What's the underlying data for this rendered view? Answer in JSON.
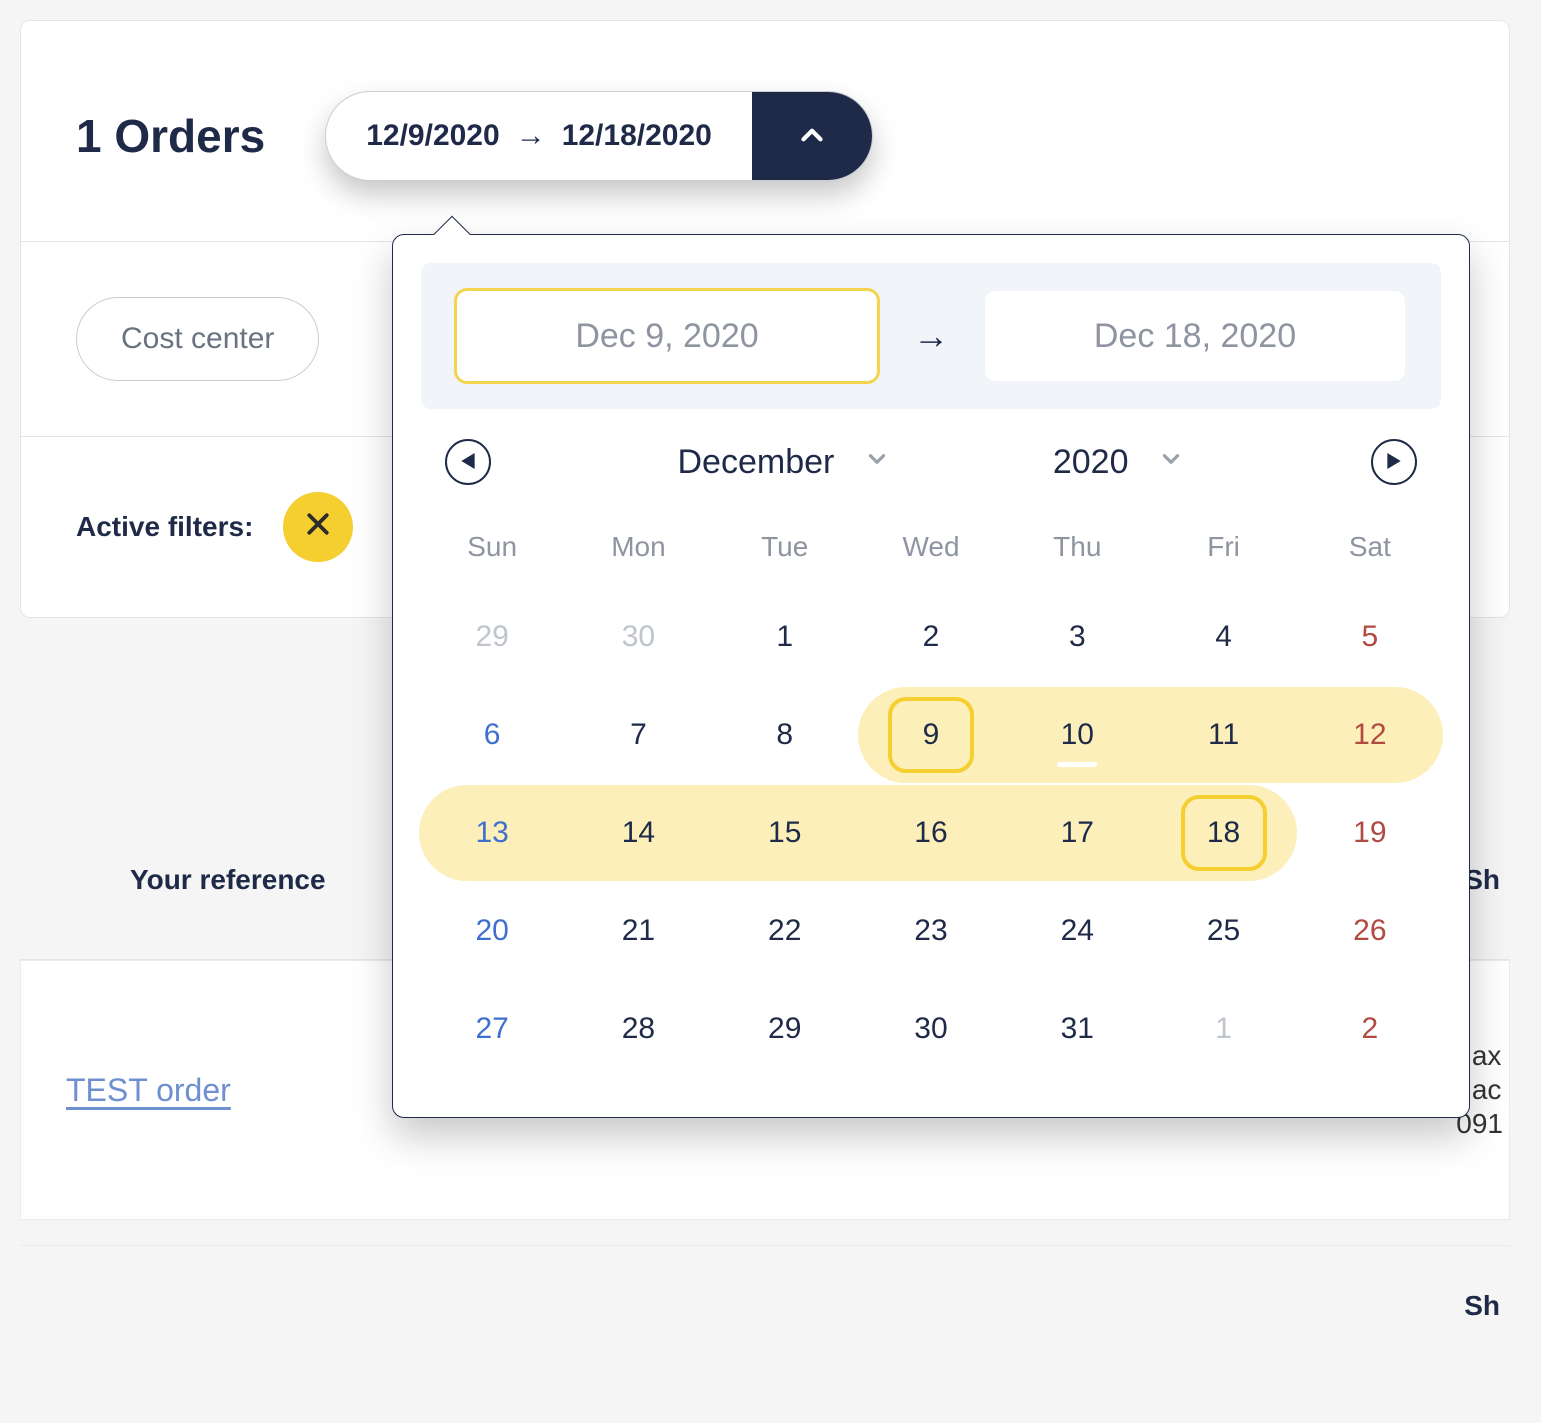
{
  "header": {
    "orders_title": "1 Orders"
  },
  "daterange": {
    "start_short": "12/9/2020",
    "end_short": "12/18/2020",
    "arrow_glyph": "→"
  },
  "filters": {
    "cost_center_label": "Cost center",
    "active_filters_label": "Active filters:"
  },
  "datepicker": {
    "start_long": "Dec 9, 2020",
    "end_long": "Dec 18, 2020",
    "month_label": "December",
    "year_label": "2020",
    "dow": [
      "Sun",
      "Mon",
      "Tue",
      "Wed",
      "Thu",
      "Fri",
      "Sat"
    ],
    "weeks": [
      [
        {
          "n": "29",
          "cls": "sun mute"
        },
        {
          "n": "30",
          "cls": "mute"
        },
        {
          "n": "1",
          "cls": ""
        },
        {
          "n": "2",
          "cls": ""
        },
        {
          "n": "3",
          "cls": ""
        },
        {
          "n": "4",
          "cls": ""
        },
        {
          "n": "5",
          "cls": "sat"
        }
      ],
      [
        {
          "n": "6",
          "cls": "sun"
        },
        {
          "n": "7",
          "cls": ""
        },
        {
          "n": "8",
          "cls": ""
        },
        {
          "n": "9",
          "cls": "inrange startcap",
          "ring": true
        },
        {
          "n": "10",
          "cls": "inrange todaybar"
        },
        {
          "n": "11",
          "cls": "inrange"
        },
        {
          "n": "12",
          "cls": "sat inrange endcap"
        }
      ],
      [
        {
          "n": "13",
          "cls": "sun inrange startcap"
        },
        {
          "n": "14",
          "cls": "inrange"
        },
        {
          "n": "15",
          "cls": "inrange"
        },
        {
          "n": "16",
          "cls": "inrange"
        },
        {
          "n": "17",
          "cls": "inrange"
        },
        {
          "n": "18",
          "cls": "inrange endcap",
          "ring": true
        },
        {
          "n": "19",
          "cls": "sat"
        }
      ],
      [
        {
          "n": "20",
          "cls": "sun"
        },
        {
          "n": "21",
          "cls": ""
        },
        {
          "n": "22",
          "cls": ""
        },
        {
          "n": "23",
          "cls": ""
        },
        {
          "n": "24",
          "cls": ""
        },
        {
          "n": "25",
          "cls": ""
        },
        {
          "n": "26",
          "cls": "sat"
        }
      ],
      [
        {
          "n": "27",
          "cls": "sun"
        },
        {
          "n": "28",
          "cls": ""
        },
        {
          "n": "29",
          "cls": ""
        },
        {
          "n": "30",
          "cls": ""
        },
        {
          "n": "31",
          "cls": ""
        },
        {
          "n": "1",
          "cls": "mute"
        },
        {
          "n": "2",
          "cls": "sat"
        }
      ]
    ]
  },
  "table": {
    "col_reference": "Your reference",
    "col_right_header": "Sh",
    "ref_link": "TEST order",
    "right_lines": [
      "nax",
      "nac",
      "091"
    ],
    "col_right_header_2": "Sh"
  }
}
